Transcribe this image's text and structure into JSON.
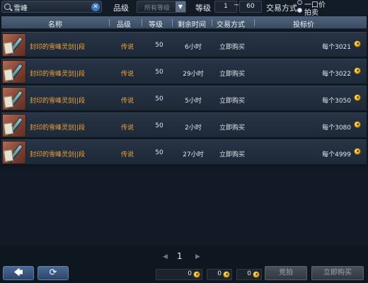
{
  "filters": {
    "search_value": "雪峰",
    "quality_label": "品级",
    "quality_value": "所有等级",
    "level_label": "等级",
    "level_min": "1",
    "level_tilde": "~",
    "level_max": "60",
    "trade_label": "交易方式",
    "trade_options": [
      "一口价",
      "拍卖"
    ]
  },
  "table": {
    "headers": {
      "name": "名称",
      "quality": "品级",
      "level": "等级",
      "time": "剩余时间",
      "trade": "交易方式",
      "price": "投标价"
    },
    "rows": [
      {
        "name": "封印的雪峰灵剑||段",
        "quality": "传说",
        "level": "50",
        "time": "6小时",
        "trade": "立即购买",
        "price": "每个3021"
      },
      {
        "name": "封印的雪峰灵剑||段",
        "quality": "传说",
        "level": "50",
        "time": "29小时",
        "trade": "立即购买",
        "price": "每个3022"
      },
      {
        "name": "封印的雪峰灵剑||段",
        "quality": "传说",
        "level": "50",
        "time": "5小时",
        "trade": "立即购买",
        "price": "每个3050"
      },
      {
        "name": "封印的雪峰灵剑||段",
        "quality": "传说",
        "level": "50",
        "time": "2小时",
        "trade": "立即购买",
        "price": "每个3080"
      },
      {
        "name": "封印的雪峰灵剑||段",
        "quality": "传说",
        "level": "50",
        "time": "27小时",
        "trade": "立即购买",
        "price": "每个4999"
      }
    ]
  },
  "pagination": {
    "prev_icon": "◀",
    "page": "1",
    "next_icon": "▶"
  },
  "bottom": {
    "back_icon": "🡄",
    "refresh_icon": "⟳",
    "money": [
      "0",
      "0",
      "0"
    ],
    "bid_label": "竞拍",
    "buy_label": "立即购买"
  }
}
